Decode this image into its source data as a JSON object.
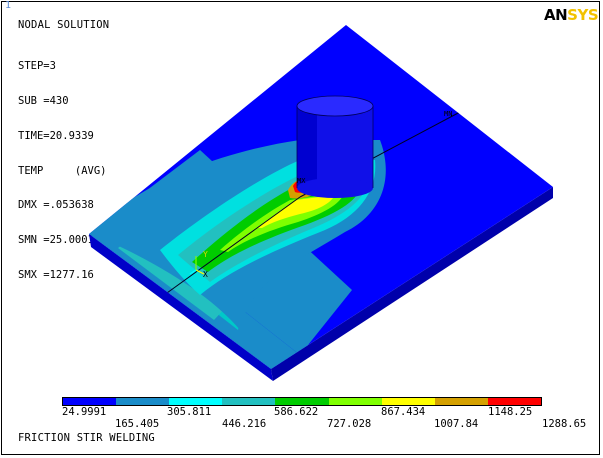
{
  "window": {
    "number": "1"
  },
  "logo": {
    "part1": "AN",
    "part2": "SYS"
  },
  "header": {
    "title": "NODAL SOLUTION",
    "lines": [
      "STEP=3",
      "SUB =430",
      "TIME=20.9339",
      "TEMP     (AVG)",
      "DMX =.053638",
      "SMN =25.0001",
      "SMX =1277.16"
    ]
  },
  "plot_labels": {
    "mx": "MX",
    "mn": "MN",
    "y_axis": "Y",
    "x_axis": "X"
  },
  "legend": {
    "colors": [
      "#0000ff",
      "#1a8cc9",
      "#00ffff",
      "#22c0c0",
      "#00cc00",
      "#7fff00",
      "#ffff00",
      "#d4a000",
      "#ff0000"
    ],
    "top_labels": [
      "24.9991",
      "305.811",
      "586.622",
      "867.434",
      "1148.25"
    ],
    "bottom_labels": [
      "165.405",
      "446.216",
      "727.028",
      "1007.84",
      "1288.65"
    ]
  },
  "caption": "FRICTION STIR WELDING"
}
